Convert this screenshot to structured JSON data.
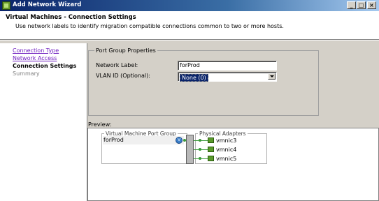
{
  "window": {
    "title": "Add Network Wizard"
  },
  "header": {
    "title": "Virtual Machines - Connection Settings",
    "subtitle": "Use network labels to identify migration compatible connections common to two or more hosts."
  },
  "nav": {
    "items": [
      {
        "label": "Connection Type",
        "state": "link"
      },
      {
        "label": "Network Access",
        "state": "link"
      },
      {
        "label": "Connection Settings",
        "state": "current"
      },
      {
        "label": "Summary",
        "state": "disabled"
      }
    ]
  },
  "port_group_properties": {
    "legend": "Port Group Properties",
    "network_label": {
      "label": "Network Label:",
      "value": "forProd"
    },
    "vlan_id": {
      "label": "VLAN ID (Optional):",
      "value": "None (0)"
    }
  },
  "preview": {
    "label": "Preview:",
    "vm_port_group": {
      "legend": "Virtual Machine Port Group",
      "name": "forProd"
    },
    "physical_adapters": {
      "legend": "Physical Adapters",
      "adapters": [
        "vmnic3",
        "vmnic4",
        "vmnic5"
      ]
    }
  },
  "colors": {
    "link": "#7020c0",
    "wire": "#3a9a3a",
    "nic": "#5a9a2a",
    "titlebar": "#0a246a"
  },
  "icons": {
    "app": "network-wizard-icon",
    "vlan": "vlan-icon",
    "nic": "nic-icon"
  }
}
